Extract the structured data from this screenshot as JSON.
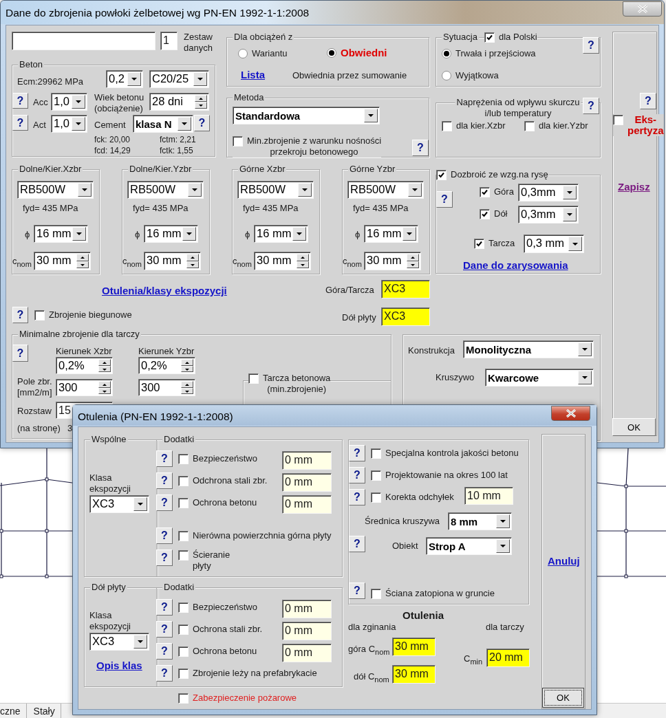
{
  "main_window": {
    "title": "Dane do zbrojenia powłoki żelbetowej wg PN-EN 1992-1-1:2008",
    "controls": [
      {
        "kind": "input"
      },
      {
        "kind": "input",
        "value": "1"
      },
      {
        "kind": "text",
        "text": "Zestaw\ndanych"
      },
      {
        "kind": "group",
        "title": "Beton"
      },
      {
        "kind": "text",
        "text": "Ecm:29962 MPa"
      },
      {
        "kind": "dropdown",
        "value": "0,2"
      },
      {
        "kind": "dropdown",
        "value": "C20/25"
      },
      {
        "kind": "help",
        "text": "?"
      },
      {
        "kind": "text",
        "text": "Acc"
      },
      {
        "kind": "dropdown",
        "value": "1,0"
      },
      {
        "kind": "text",
        "text": "Wiek betonu\n(obciążenie)"
      },
      {
        "kind": "spinner",
        "value": "28 dni"
      },
      {
        "kind": "help",
        "text": "?"
      },
      {
        "kind": "text",
        "text": "Act"
      },
      {
        "kind": "dropdown",
        "value": "1,0"
      },
      {
        "kind": "text",
        "text": "Cement"
      },
      {
        "kind": "dropdown",
        "value": "klasa N",
        "bold": true
      },
      {
        "kind": "help",
        "text": "?"
      },
      {
        "kind": "text",
        "text": "fck: 20,00"
      },
      {
        "kind": "text",
        "text": "fctm: 2,21"
      },
      {
        "kind": "text",
        "text": "fcd: 14,29"
      },
      {
        "kind": "text",
        "text": "fctk: 1,55"
      },
      {
        "kind": "group",
        "title": "Dla obciążeń z"
      },
      {
        "kind": "radio",
        "label": "Wariantu",
        "selected": false
      },
      {
        "kind": "radio",
        "label": "Obwiedni",
        "selected": true,
        "bold": true,
        "color": "#e00000"
      },
      {
        "kind": "link",
        "text": "Lista"
      },
      {
        "kind": "text",
        "text": "Obwiednia przez sumowanie"
      },
      {
        "kind": "group",
        "title": "Metoda"
      },
      {
        "kind": "dropdown",
        "value": "Standardowa",
        "bold": true
      },
      {
        "kind": "checkbox",
        "label": "Min.zbrojenie z warunku nośności\nprzekroju betonowego",
        "checked": false
      },
      {
        "kind": "help",
        "text": "?"
      },
      {
        "kind": "group",
        "title": "Sytuacja"
      },
      {
        "kind": "checkbox",
        "label": "dla Polski",
        "checked": true
      },
      {
        "kind": "help",
        "text": "?"
      },
      {
        "kind": "radio",
        "label": "Trwała i przejściowa",
        "selected": true
      },
      {
        "kind": "radio",
        "label": "Wyjątkowa",
        "selected": false
      },
      {
        "kind": "group",
        "title": "Naprężenia od wpływu skurczu\ni/lub temperatury"
      },
      {
        "kind": "help",
        "text": "?"
      },
      {
        "kind": "checkbox",
        "label": "dla kier.Xzbr",
        "checked": false
      },
      {
        "kind": "checkbox",
        "label": "dla kier.Yzbr",
        "checked": false
      },
      {
        "kind": "help",
        "text": "?"
      },
      {
        "kind": "checkbox",
        "label": "Eks-\npertyza",
        "checked": false,
        "bold": true,
        "color": "#d00000"
      },
      {
        "kind": "link",
        "text": "Zapisz",
        "visited": true
      },
      {
        "kind": "button",
        "text": "OK"
      },
      {
        "kind": "group",
        "title": "Dolne/Kier.Xzbr"
      },
      {
        "kind": "dropdown",
        "value": "RB500W"
      },
      {
        "kind": "text",
        "text": "fyd= 435 MPa"
      },
      {
        "kind": "text",
        "text": "ϕ"
      },
      {
        "kind": "dropdown",
        "value": "16 mm"
      },
      {
        "kind": "text",
        "text": "c$_{nom}$"
      },
      {
        "kind": "spinner",
        "value": "30 mm"
      },
      {
        "kind": "group",
        "title": "Dolne/Kier.Yzbr"
      },
      {
        "kind": "dropdown",
        "value": "RB500W"
      },
      {
        "kind": "text",
        "text": "fyd= 435 MPa"
      },
      {
        "kind": "text",
        "text": "ϕ"
      },
      {
        "kind": "dropdown",
        "value": "16 mm"
      },
      {
        "kind": "text",
        "text": "c$_{nom}$"
      },
      {
        "kind": "spinner",
        "value": "30 mm"
      },
      {
        "kind": "group",
        "title": "Górne Xzbr"
      },
      {
        "kind": "dropdown",
        "value": "RB500W"
      },
      {
        "kind": "text",
        "text": "fyd= 435 MPa"
      },
      {
        "kind": "text",
        "text": "ϕ"
      },
      {
        "kind": "dropdown",
        "value": "16 mm"
      },
      {
        "kind": "text",
        "text": "c$_{nom}$"
      },
      {
        "kind": "spinner",
        "value": "30 mm"
      },
      {
        "kind": "group",
        "title": "Górne Yzbr"
      },
      {
        "kind": "dropdown",
        "value": "RB500W"
      },
      {
        "kind": "text",
        "text": "fyd= 435 MPa"
      },
      {
        "kind": "text",
        "text": "ϕ"
      },
      {
        "kind": "dropdown",
        "value": "16 mm"
      },
      {
        "kind": "text",
        "text": "c$_{nom}$"
      },
      {
        "kind": "spinner",
        "value": "30 mm"
      },
      {
        "kind": "frame"
      },
      {
        "kind": "checkbox",
        "label": "Dozbroić ze wzg.na rysę",
        "checked": true
      },
      {
        "kind": "help",
        "text": "?"
      },
      {
        "kind": "checkbox",
        "label": "Góra",
        "checked": true
      },
      {
        "kind": "dropdown",
        "value": "0,3mm"
      },
      {
        "kind": "checkbox",
        "label": "Dół",
        "checked": true
      },
      {
        "kind": "dropdown",
        "value": "0,3mm"
      },
      {
        "kind": "checkbox",
        "label": "Tarcza",
        "checked": true
      },
      {
        "kind": "dropdown",
        "value": "0,3 mm"
      },
      {
        "kind": "link",
        "text": "Dane do zarysowania"
      },
      {
        "kind": "link",
        "text": "Otulenia/klasy ekspozycji"
      },
      {
        "kind": "text",
        "text": "Góra/Tarcza"
      },
      {
        "kind": "result",
        "value": "XC3"
      },
      {
        "kind": "help",
        "text": "?"
      },
      {
        "kind": "checkbox",
        "label": "Zbrojenie biegunowe",
        "checked": false
      },
      {
        "kind": "text",
        "text": "Dół płyty"
      },
      {
        "kind": "result",
        "value": "XC3"
      },
      {
        "kind": "group",
        "title": "Minimalne zbrojenie dla tarczy"
      },
      {
        "kind": "help",
        "text": "?"
      },
      {
        "kind": "text",
        "text": "Kierunek Xzbr"
      },
      {
        "kind": "text",
        "text": "Kierunek Yzbr"
      },
      {
        "kind": "spinner",
        "value": "0,2%"
      },
      {
        "kind": "spinner",
        "value": "0,2%"
      },
      {
        "kind": "text",
        "text": "Pole zbr.\n[mm2/m]"
      },
      {
        "kind": "spinner",
        "value": "300"
      },
      {
        "kind": "spinner",
        "value": "300"
      },
      {
        "kind": "text",
        "text": "Rozstaw"
      },
      {
        "kind": "input",
        "value": "15"
      },
      {
        "kind": "text",
        "text": "(na stronę)"
      },
      {
        "kind": "text",
        "text": "3"
      },
      {
        "kind": "frame"
      },
      {
        "kind": "checkbox",
        "label": "Tarcza betonowa\n(min.zbrojenie)",
        "checked": false
      },
      {
        "kind": "frame"
      },
      {
        "kind": "text",
        "text": "Konstrukcja"
      },
      {
        "kind": "dropdown",
        "value": "Monolityczna",
        "bold": true
      },
      {
        "kind": "text",
        "text": "Kruszywo"
      },
      {
        "kind": "dropdown",
        "value": "Kwarcowe",
        "bold": true
      }
    ]
  },
  "popup_window": {
    "title": "Otulenia (PN-EN 1992-1-1:2008)",
    "controls": [
      {
        "kind": "group",
        "title": "Wspólne"
      },
      {
        "kind": "text",
        "text": "Klasa\nekspozycji"
      },
      {
        "kind": "dropdown",
        "value": "XC3"
      },
      {
        "kind": "group",
        "title": "Dodatki"
      },
      {
        "kind": "help",
        "text": "?"
      },
      {
        "kind": "checkbox",
        "label": "Bezpieczeństwo",
        "checked": false
      },
      {
        "kind": "extra",
        "value": "0 mm"
      },
      {
        "kind": "help",
        "text": "?"
      },
      {
        "kind": "checkbox",
        "label": "Odchrona stali zbr.",
        "checked": false
      },
      {
        "kind": "extra",
        "value": "0 mm"
      },
      {
        "kind": "help",
        "text": "?"
      },
      {
        "kind": "checkbox",
        "label": "Ochrona betonu",
        "checked": false
      },
      {
        "kind": "extra",
        "value": "0 mm"
      },
      {
        "kind": "help",
        "text": "?"
      },
      {
        "kind": "checkbox",
        "label": "Nierówna powierzchnia górna płyty",
        "checked": false
      },
      {
        "kind": "help",
        "text": "?"
      },
      {
        "kind": "checkbox",
        "label": "Ścieranie\n płyty",
        "checked": false
      },
      {
        "kind": "group",
        "title": "Dół płyty"
      },
      {
        "kind": "text",
        "text": "Klasa\nekspozycji"
      },
      {
        "kind": "dropdown",
        "value": "XC3"
      },
      {
        "kind": "link",
        "text": "Opis klas"
      },
      {
        "kind": "group",
        "title": "Dodatki"
      },
      {
        "kind": "help",
        "text": "?"
      },
      {
        "kind": "checkbox",
        "label": "Bezpieczeństwo",
        "checked": false
      },
      {
        "kind": "extra",
        "value": "0 mm"
      },
      {
        "kind": "help",
        "text": "?"
      },
      {
        "kind": "checkbox",
        "label": "Ochrona stali zbr.",
        "checked": false
      },
      {
        "kind": "extra",
        "value": "0 mm"
      },
      {
        "kind": "help",
        "text": "?"
      },
      {
        "kind": "checkbox",
        "label": "Ochrona betonu",
        "checked": false
      },
      {
        "kind": "extra",
        "value": "0 mm"
      },
      {
        "kind": "help",
        "text": "?"
      },
      {
        "kind": "checkbox",
        "label": "Zbrojenie leży na prefabrykacie",
        "checked": false
      },
      {
        "kind": "checkbox",
        "label": "Zabezpieczenie pożarowe",
        "checked": false,
        "color": "#e02020"
      },
      {
        "kind": "frame"
      },
      {
        "kind": "help",
        "text": "?"
      },
      {
        "kind": "checkbox",
        "label": "Specjalna kontrola jakości betonu",
        "checked": false
      },
      {
        "kind": "help",
        "text": "?"
      },
      {
        "kind": "checkbox",
        "label": "Projektowanie na okres 100 lat",
        "checked": false
      },
      {
        "kind": "help",
        "text": "?"
      },
      {
        "kind": "checkbox",
        "label": "Korekta odchyłek",
        "checked": false
      },
      {
        "kind": "extra",
        "value": "10 mm"
      },
      {
        "kind": "text",
        "text": "Średnica kruszywa"
      },
      {
        "kind": "dropdown",
        "value": "8 mm",
        "bold": true
      },
      {
        "kind": "help",
        "text": "?"
      },
      {
        "kind": "text",
        "text": "Obiekt"
      },
      {
        "kind": "dropdown",
        "value": "Strop A",
        "bold": true
      },
      {
        "kind": "help",
        "text": "?"
      },
      {
        "kind": "checkbox",
        "label": "Ściana zatopiona w gruncie",
        "checked": false
      },
      {
        "kind": "text",
        "text": "Otulenia",
        "bold": true
      },
      {
        "kind": "text",
        "text": "dla zginania"
      },
      {
        "kind": "text",
        "text": "dla tarczy"
      },
      {
        "kind": "text",
        "text": "góra C$_{nom}$"
      },
      {
        "kind": "result",
        "value": "30 mm"
      },
      {
        "kind": "text",
        "text": "dół C$_{nom}$"
      },
      {
        "kind": "result",
        "value": "30 mm"
      },
      {
        "kind": "text",
        "text": "C$_{min}$"
      },
      {
        "kind": "result",
        "value": "20 mm"
      },
      {
        "kind": "link",
        "text": "Anuluj"
      },
      {
        "kind": "button",
        "text": "OK",
        "focused": true
      }
    ]
  },
  "status_bar": {
    "tabs": [
      "czne",
      "Stały"
    ]
  }
}
